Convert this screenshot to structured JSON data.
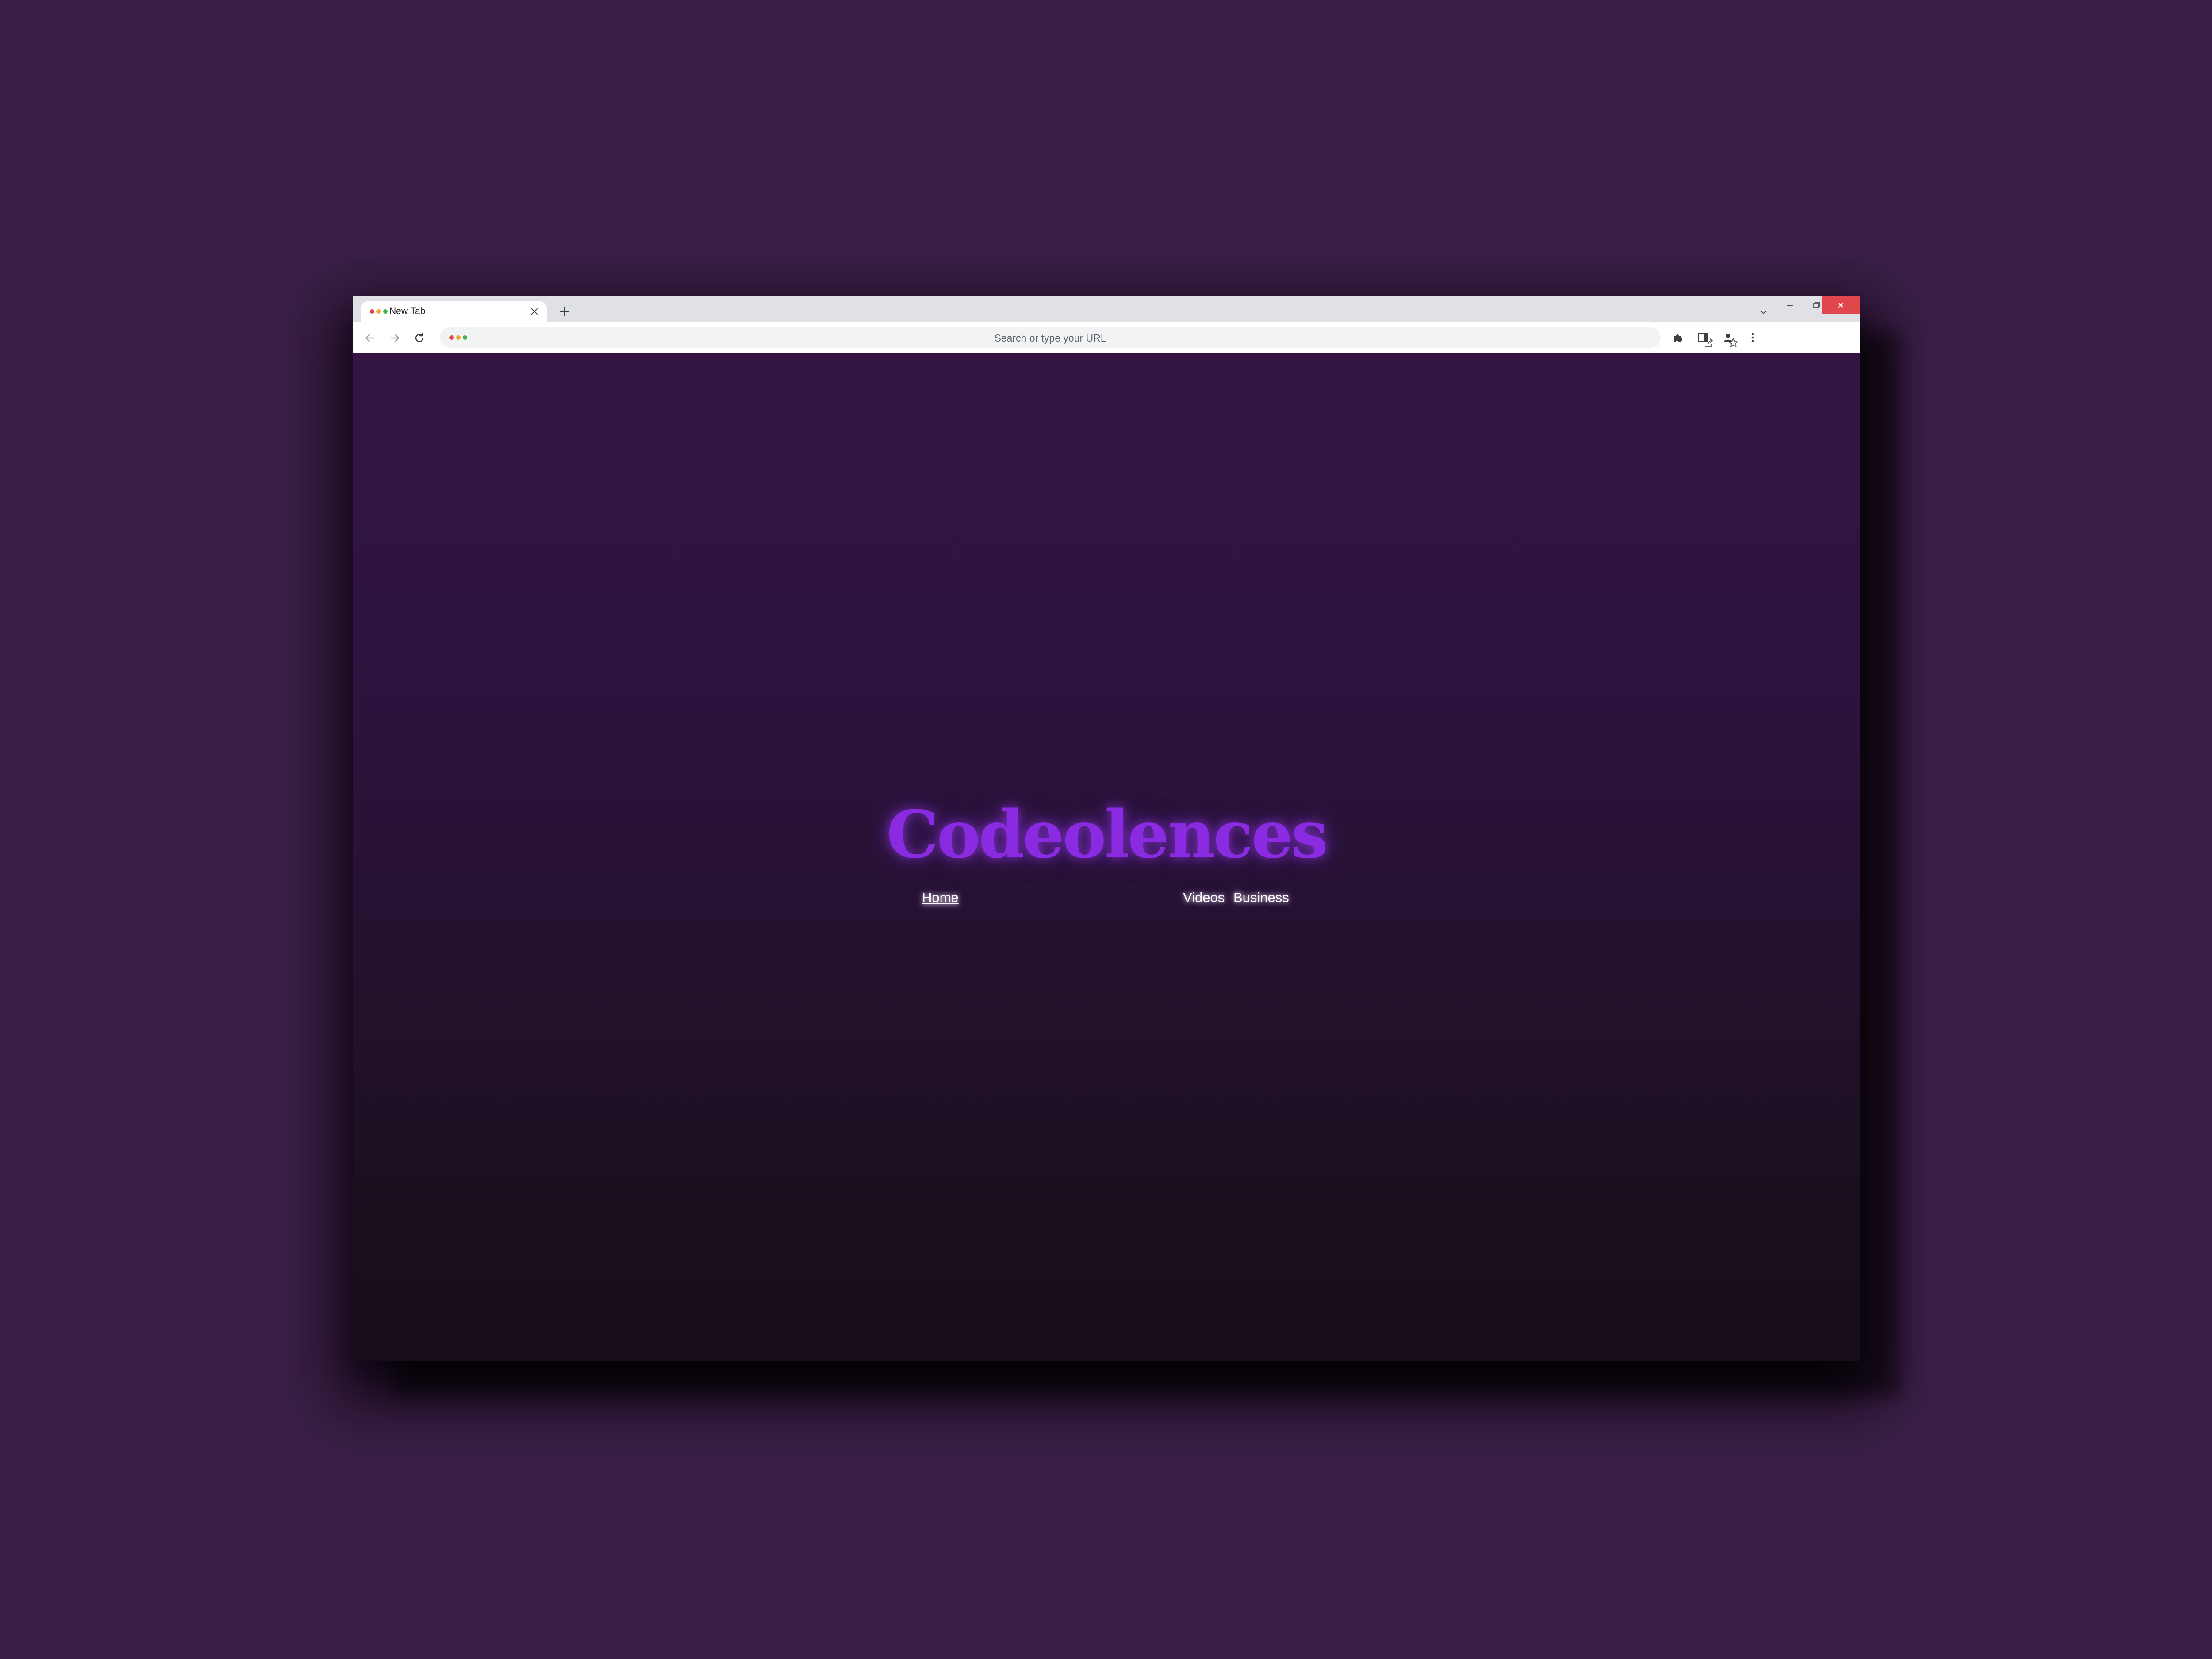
{
  "browser": {
    "tab_title": "New Tab",
    "omnibox_placeholder": "Search or type your URL",
    "dot_colors": [
      "#e0474c",
      "#f5a623",
      "#4caf50"
    ]
  },
  "page": {
    "site_title": "Codeolences",
    "nav": {
      "home": "Home",
      "videos": "Videos",
      "business": "Business"
    }
  },
  "colors": {
    "desktop_background": "#3a1e46",
    "title_accent": "#8a2be2",
    "close_button": "#e0474c"
  },
  "icons": [
    "close-icon",
    "plus-icon",
    "chevron-down-icon",
    "minimize-icon",
    "restore-icon",
    "back-arrow-icon",
    "forward-arrow-icon",
    "reload-icon",
    "share-icon",
    "star-icon",
    "puzzle-icon",
    "side-panel-icon",
    "profile-icon",
    "kebab-menu-icon"
  ]
}
